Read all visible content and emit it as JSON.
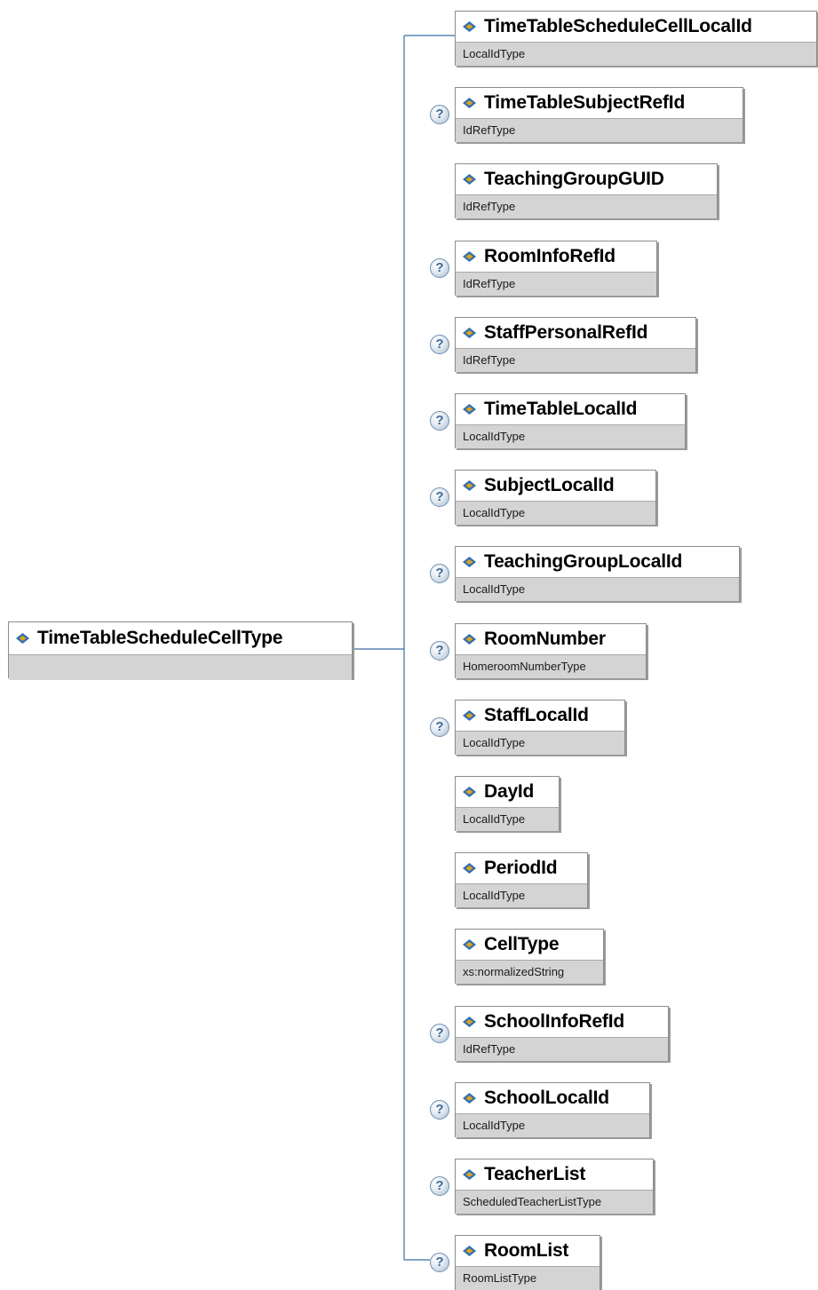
{
  "root": {
    "name": "TimeTableScheduleCellType",
    "type": ""
  },
  "elements": [
    {
      "name": "TimeTableScheduleCellLocalId",
      "type": "LocalIdType",
      "optional": false
    },
    {
      "name": "TimeTableSubjectRefId",
      "type": "IdRefType",
      "optional": true
    },
    {
      "name": "TeachingGroupGUID",
      "type": "IdRefType",
      "optional": false
    },
    {
      "name": "RoomInfoRefId",
      "type": "IdRefType",
      "optional": true
    },
    {
      "name": "StaffPersonalRefId",
      "type": "IdRefType",
      "optional": true
    },
    {
      "name": "TimeTableLocalId",
      "type": "LocalIdType",
      "optional": true
    },
    {
      "name": "SubjectLocalId",
      "type": "LocalIdType",
      "optional": true
    },
    {
      "name": "TeachingGroupLocalId",
      "type": "LocalIdType",
      "optional": true
    },
    {
      "name": "RoomNumber",
      "type": "HomeroomNumberType",
      "optional": true
    },
    {
      "name": "StaffLocalId",
      "type": "LocalIdType",
      "optional": true
    },
    {
      "name": "DayId",
      "type": "LocalIdType",
      "optional": false
    },
    {
      "name": "PeriodId",
      "type": "LocalIdType",
      "optional": false
    },
    {
      "name": "CellType",
      "type": "xs:normalizedString",
      "optional": false
    },
    {
      "name": "SchoolInfoRefId",
      "type": "IdRefType",
      "optional": true
    },
    {
      "name": "SchoolLocalId",
      "type": "LocalIdType",
      "optional": true
    },
    {
      "name": "TeacherList",
      "type": "ScheduledTeacherListType",
      "optional": true
    },
    {
      "name": "RoomList",
      "type": "RoomListType",
      "optional": true
    }
  ],
  "colors": {
    "connector": "#3a6ea5",
    "icon_blue": "#2f6fb3",
    "icon_gold": "#e0a21a",
    "type_band": "#d4d4d4"
  },
  "optional_marker": "?",
  "icons": {
    "element": "element-diamond-icon",
    "optional": "question-mark-icon"
  }
}
